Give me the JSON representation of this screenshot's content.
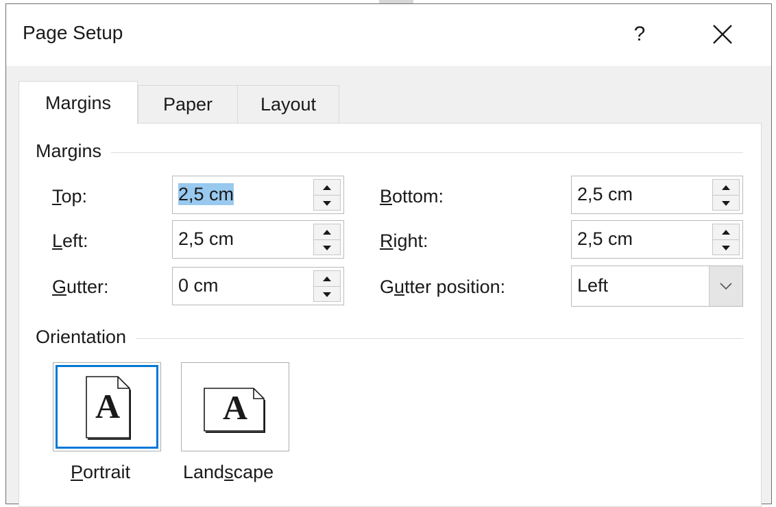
{
  "dialog": {
    "title": "Page Setup",
    "help_label": "?"
  },
  "tabs": [
    {
      "label": "Margins",
      "active": true
    },
    {
      "label": "Paper",
      "active": false
    },
    {
      "label": "Layout",
      "active": false
    }
  ],
  "margins_group": {
    "label": "Margins",
    "top": {
      "label_key": "T",
      "label_rest": "op:",
      "value": "2,5 cm"
    },
    "bottom": {
      "label_key": "B",
      "label_rest": "ottom:",
      "value": "2,5 cm"
    },
    "left": {
      "label_key": "L",
      "label_rest": "eft:",
      "value": "2,5 cm"
    },
    "right": {
      "label_key": "R",
      "label_rest": "ight:",
      "value": "2,5 cm"
    },
    "gutter": {
      "label_key": "G",
      "label_rest": "utter:",
      "value": "0 cm"
    },
    "gutter_position": {
      "label_pre": "G",
      "label_key": "u",
      "label_rest": "tter position:",
      "value": "Left"
    }
  },
  "orientation_group": {
    "label": "Orientation",
    "portrait": {
      "caption_key": "P",
      "caption_rest": "ortrait",
      "glyph": "A",
      "selected": true
    },
    "landscape": {
      "caption_pre": "Land",
      "caption_key": "s",
      "caption_rest": "cape",
      "glyph": "A",
      "selected": false
    }
  },
  "colors": {
    "accent": "#0078d7",
    "selection": "#99c9ef",
    "dialog_bg": "#f0f0f0"
  }
}
